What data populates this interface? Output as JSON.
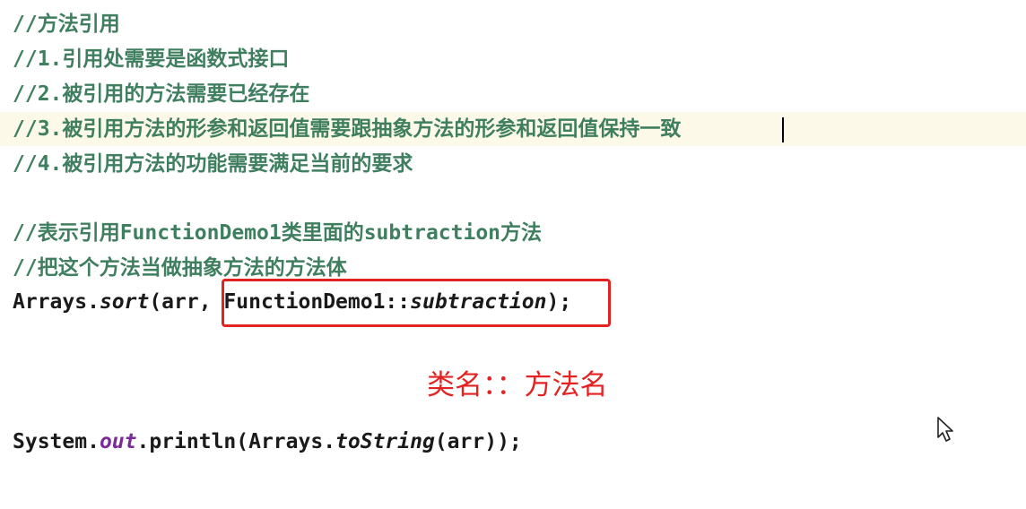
{
  "editor": {
    "comments": [
      "//方法引用",
      "//1.引用处需要是函数式接口",
      "//2.被引用的方法需要已经存在",
      "//3.被引用方法的形参和返回值需要跟抽象方法的形参和返回值保持一致",
      "//4.被引用方法的功能需要满足当前的要求"
    ],
    "comment_block_2": [
      "//表示引用FunctionDemo1类里面的subtraction方法",
      "//把这个方法当做抽象方法的方法体"
    ],
    "sort_call": {
      "prefix": "Arrays.",
      "method": "sort",
      "args_start": "(arr, ",
      "class_ref": "FunctionDemo1::",
      "method_ref": "subtraction",
      "end": ");"
    },
    "print_call": {
      "part1": "System.",
      "out": "out",
      "part2": ".println(Arrays.",
      "tostring": "toString",
      "part3": "(arr));"
    }
  },
  "annotation": {
    "text": "类名：：方法名"
  },
  "colors": {
    "comment": "#3f7f5f",
    "annotation": "#e32222",
    "field": "#7a2a9a",
    "active_line": "#fcf9e8"
  },
  "icons": {
    "cursor": "mouse-pointer-icon"
  }
}
